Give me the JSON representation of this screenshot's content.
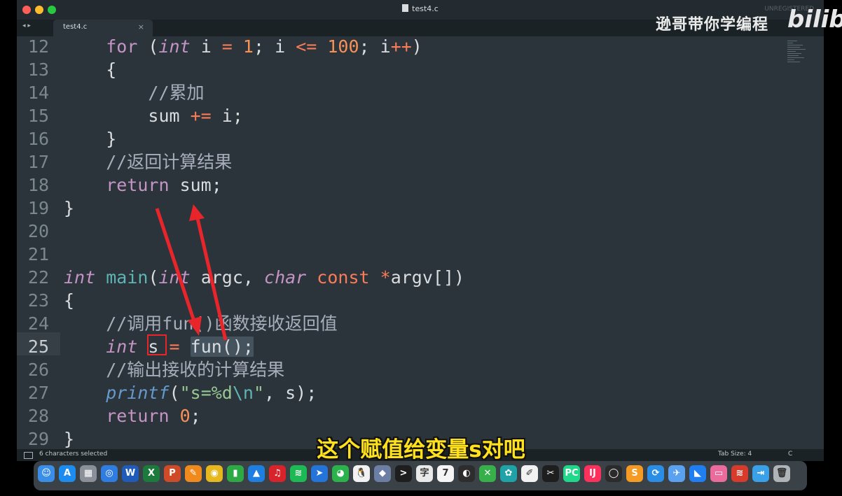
{
  "window": {
    "title": "test4.c",
    "registration": "UNREGISTERED"
  },
  "tab": {
    "label": "test4.c",
    "close": "×"
  },
  "nav_arrows": "◂ ▸",
  "watermark": {
    "channel": "逊哥带你学编程",
    "logo": "bilibili"
  },
  "editor": {
    "current_line": 25,
    "lines": [
      {
        "n": 12,
        "tokens": [
          [
            "pu",
            "    "
          ],
          [
            "kw",
            "for"
          ],
          [
            "pu",
            " ("
          ],
          [
            "ty",
            "int"
          ],
          [
            "pu",
            " i "
          ],
          [
            "op",
            "="
          ],
          [
            "pu",
            " "
          ],
          [
            "nu",
            "1"
          ],
          [
            "pu",
            "; i "
          ],
          [
            "op",
            "<="
          ],
          [
            "pu",
            " "
          ],
          [
            "nu",
            "100"
          ],
          [
            "pu",
            "; i"
          ],
          [
            "op",
            "++"
          ],
          [
            "pu",
            ")"
          ]
        ]
      },
      {
        "n": 13,
        "tokens": [
          [
            "pu",
            "    {"
          ]
        ]
      },
      {
        "n": 14,
        "tokens": [
          [
            "cm",
            "        //累加"
          ]
        ]
      },
      {
        "n": 15,
        "tokens": [
          [
            "pu",
            "        sum "
          ],
          [
            "op",
            "+="
          ],
          [
            "pu",
            " i;"
          ]
        ]
      },
      {
        "n": 16,
        "tokens": [
          [
            "pu",
            "    }"
          ]
        ]
      },
      {
        "n": 17,
        "tokens": [
          [
            "cm",
            "    //返回计算结果"
          ]
        ]
      },
      {
        "n": 18,
        "tokens": [
          [
            "pu",
            "    "
          ],
          [
            "kw",
            "return"
          ],
          [
            "pu",
            " sum;"
          ]
        ]
      },
      {
        "n": 19,
        "tokens": [
          [
            "pu",
            "}"
          ]
        ]
      },
      {
        "n": 20,
        "tokens": []
      },
      {
        "n": 21,
        "tokens": []
      },
      {
        "n": 22,
        "tokens": [
          [
            "ty",
            "int"
          ],
          [
            "pu",
            " "
          ],
          [
            "fn",
            "main"
          ],
          [
            "pu",
            "("
          ],
          [
            "ty",
            "int"
          ],
          [
            "pu",
            " argc, "
          ],
          [
            "ty",
            "char"
          ],
          [
            "pu",
            " "
          ],
          [
            "op",
            "const"
          ],
          [
            "pu",
            " "
          ],
          [
            "op",
            "*"
          ],
          [
            "pu",
            "argv[])"
          ]
        ]
      },
      {
        "n": 23,
        "tokens": [
          [
            "pu",
            "{"
          ]
        ]
      },
      {
        "n": 24,
        "tokens": [
          [
            "cm",
            "    //调用fun()函数接收返回值"
          ]
        ]
      },
      {
        "n": 25,
        "tokens": [
          [
            "pu",
            "    "
          ],
          [
            "ty",
            "int"
          ],
          [
            "pu",
            " s "
          ],
          [
            "op",
            "="
          ],
          [
            "pu",
            " "
          ],
          [
            "sel",
            "fun();"
          ]
        ]
      },
      {
        "n": 26,
        "tokens": [
          [
            "cm",
            "    //输出接收的计算结果"
          ]
        ]
      },
      {
        "n": 27,
        "tokens": [
          [
            "pu",
            "    "
          ],
          [
            "fni",
            "printf"
          ],
          [
            "pu",
            "("
          ],
          [
            "st",
            "\"s=%d"
          ],
          [
            "es",
            "\\n"
          ],
          [
            "st",
            "\""
          ],
          [
            "pu",
            ", s);"
          ]
        ]
      },
      {
        "n": 28,
        "tokens": [
          [
            "pu",
            "    "
          ],
          [
            "kw",
            "return"
          ],
          [
            "pu",
            " "
          ],
          [
            "nu",
            "0"
          ],
          [
            "pu",
            ";"
          ]
        ]
      },
      {
        "n": 29,
        "tokens": [
          [
            "pu",
            "}"
          ]
        ]
      }
    ]
  },
  "status": {
    "selection": "6 characters selected",
    "tab_size": "Tab Size: 4",
    "syntax": "C"
  },
  "subtitle": "这个赋值给变量s对吧",
  "dock": {
    "icons": [
      {
        "name": "finder-icon",
        "color": "#3b8ee8",
        "glyph": "☺"
      },
      {
        "name": "app-store-icon",
        "color": "#1c8cf0",
        "glyph": "A"
      },
      {
        "name": "launchpad-icon",
        "color": "#8a8f99",
        "glyph": "▦"
      },
      {
        "name": "safari-icon",
        "color": "#2f7de0",
        "glyph": "◎"
      },
      {
        "name": "word-icon",
        "color": "#1f5bb8",
        "glyph": "W"
      },
      {
        "name": "excel-icon",
        "color": "#1d7a3d",
        "glyph": "X"
      },
      {
        "name": "powerpoint-icon",
        "color": "#cf4a26",
        "glyph": "P"
      },
      {
        "name": "pages-icon",
        "color": "#f08a1c",
        "glyph": "✎"
      },
      {
        "name": "chrome-icon",
        "color": "#e6b81d",
        "glyph": "◉"
      },
      {
        "name": "numbers-icon",
        "color": "#2eaa45",
        "glyph": "▮"
      },
      {
        "name": "keynote-icon",
        "color": "#1e7fe0",
        "glyph": "▲"
      },
      {
        "name": "netease-music-icon",
        "color": "#d8232a",
        "glyph": "♫"
      },
      {
        "name": "spotify-icon",
        "color": "#1db954",
        "glyph": "≋"
      },
      {
        "name": "paw-icon",
        "color": "#2574d9",
        "glyph": "➤"
      },
      {
        "name": "wechat-icon",
        "color": "#2bb24c",
        "glyph": "◕"
      },
      {
        "name": "qq-icon",
        "color": "#f2f2f2",
        "glyph": "🐧"
      },
      {
        "name": "games-icon",
        "color": "#6c7ea3",
        "glyph": "◆"
      },
      {
        "name": "terminal-icon",
        "color": "#1e1e1e",
        "glyph": ">"
      },
      {
        "name": "dictionary-icon",
        "color": "#e9e9e9",
        "glyph": "字"
      },
      {
        "name": "calendar-icon",
        "color": "#f5f5f5",
        "glyph": "7"
      },
      {
        "name": "obs-icon",
        "color": "#2d2d2d",
        "glyph": "◐"
      },
      {
        "name": "xmind-icon",
        "color": "#37b04c",
        "glyph": "✕"
      },
      {
        "name": "bluetooth-icon",
        "color": "#1fa3a8",
        "glyph": "✿"
      },
      {
        "name": "script-editor-icon",
        "color": "#f2f2f2",
        "glyph": "✐"
      },
      {
        "name": "capcut-icon",
        "color": "#1e1e1e",
        "glyph": "✂"
      },
      {
        "name": "pycharm-icon",
        "color": "#21d789",
        "glyph": "PC"
      },
      {
        "name": "intellij-icon",
        "color": "#fe315d",
        "glyph": "IJ"
      },
      {
        "name": "activity-ring-icon",
        "color": "#2b2b2b",
        "glyph": "◯"
      },
      {
        "name": "sublime-text-icon",
        "color": "#f59a23",
        "glyph": "S"
      },
      {
        "name": "vpn-icon",
        "color": "#2a8de6",
        "glyph": "⟳"
      },
      {
        "name": "swift-icon",
        "color": "#5aa2ef",
        "glyph": "✈"
      },
      {
        "name": "dingtalk-icon",
        "color": "#1f7ef2",
        "glyph": "◣"
      },
      {
        "name": "screenshot-icon",
        "color": "#ec6b9d",
        "glyph": "▭"
      },
      {
        "name": "fan-icon",
        "color": "#d63b2c",
        "glyph": "≋"
      },
      {
        "name": "migrate-icon",
        "color": "#3aa0e8",
        "glyph": "⇥"
      },
      {
        "name": "trash-icon",
        "color": "#aeb4b8",
        "glyph": "🗑"
      }
    ]
  }
}
